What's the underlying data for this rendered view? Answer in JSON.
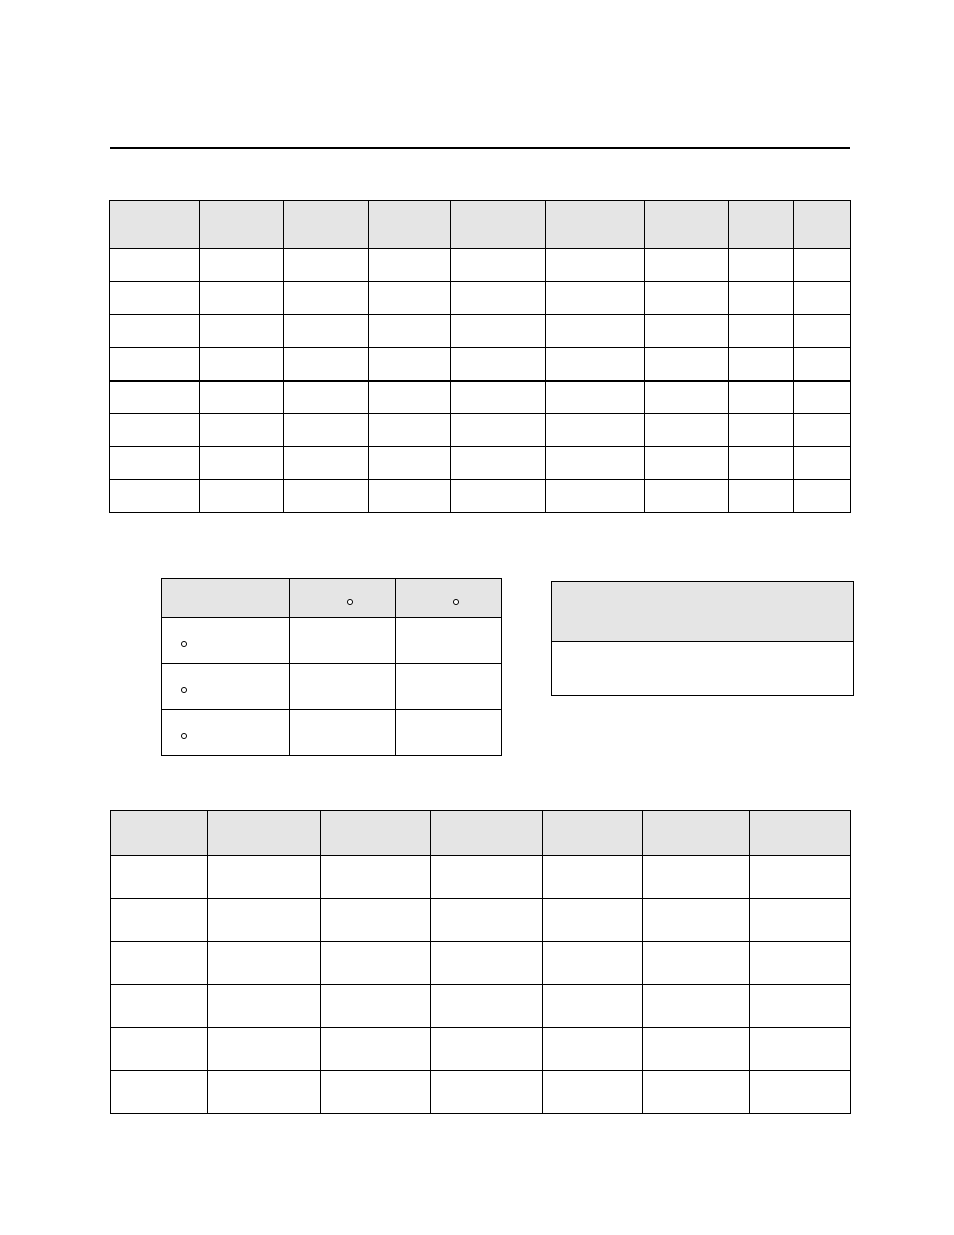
{
  "hr": "",
  "table1": {
    "headers": [
      "",
      "",
      "",
      "",
      "",
      "",
      "",
      "",
      ""
    ],
    "rows": [
      [
        "",
        "",
        "",
        "",
        "",
        "",
        "",
        "",
        ""
      ],
      [
        "",
        "",
        "",
        "",
        "",
        "",
        "",
        "",
        ""
      ],
      [
        "",
        "",
        "",
        "",
        "",
        "",
        "",
        "",
        ""
      ],
      [
        "",
        "",
        "",
        "",
        "",
        "",
        "",
        "",
        ""
      ],
      [
        "",
        "",
        "",
        "",
        "",
        "",
        "",
        "",
        ""
      ],
      [
        "",
        "",
        "",
        "",
        "",
        "",
        "",
        "",
        ""
      ],
      [
        "",
        "",
        "",
        "",
        "",
        "",
        "",
        "",
        ""
      ],
      [
        "",
        "",
        "",
        "",
        "",
        "",
        "",
        "",
        ""
      ]
    ]
  },
  "table2": {
    "headers": [
      "",
      "",
      ""
    ],
    "header_marks": [
      "",
      "°",
      "°"
    ],
    "rows": [
      {
        "mark": "°",
        "cells": [
          "",
          "",
          ""
        ]
      },
      {
        "mark": "°",
        "cells": [
          "",
          "",
          ""
        ]
      },
      {
        "mark": "°",
        "cells": [
          "",
          "",
          ""
        ]
      }
    ]
  },
  "table3": {
    "header": "",
    "cell": ""
  },
  "table4": {
    "headers": [
      "",
      "",
      "",
      "",
      "",
      "",
      ""
    ],
    "rows": [
      [
        "",
        "",
        "",
        "",
        "",
        "",
        ""
      ],
      [
        "",
        "",
        "",
        "",
        "",
        "",
        ""
      ],
      [
        "",
        "",
        "",
        "",
        "",
        "",
        ""
      ],
      [
        "",
        "",
        "",
        "",
        "",
        "",
        ""
      ],
      [
        "",
        "",
        "",
        "",
        "",
        "",
        ""
      ],
      [
        "",
        "",
        "",
        "",
        "",
        "",
        ""
      ]
    ]
  }
}
